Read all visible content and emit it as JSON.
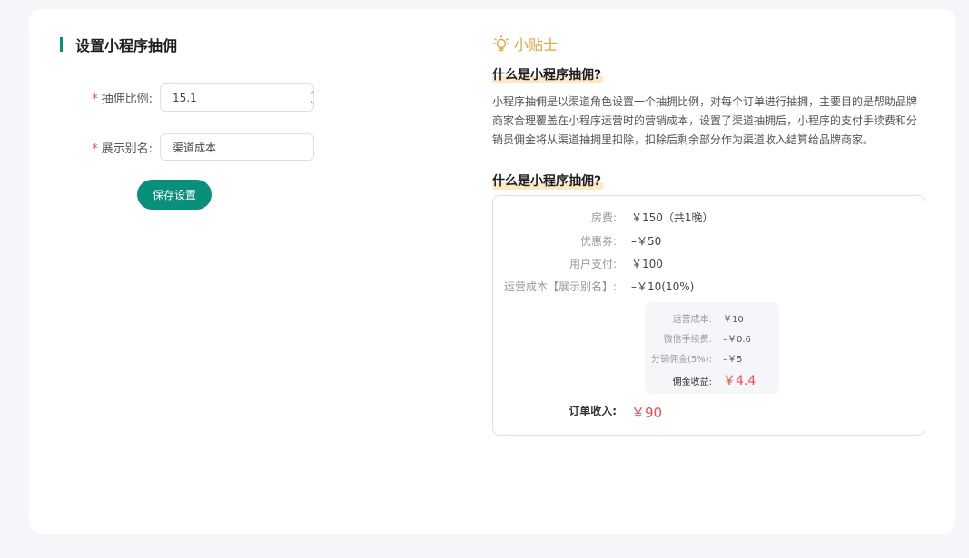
{
  "form": {
    "title": "设置小程序抽佣",
    "rate_label": "抽佣比例:",
    "rate_value": "15.1",
    "rate_unit": "%",
    "alias_label": "展示别名:",
    "alias_value": "渠道成本",
    "required_mark": "*",
    "save_label": "保存设置"
  },
  "tips": {
    "title": "小贴士",
    "q1": "什么是小程序抽佣?",
    "description": "小程序抽佣是以渠道角色设置一个抽拥比例，对每个订单进行抽拥，主要目的是帮助品牌商家合理覆盖在小程序运营时的营销成本，设置了渠道抽拥后，小程序的支付手续费和分销员佣金将从渠道抽拥里扣除，扣除后剩余部分作为渠道收入结算给品牌商家。",
    "q2": "什么是小程序抽佣?",
    "example": {
      "rows": [
        {
          "label": "房费:",
          "value": "￥150（共1晚）"
        },
        {
          "label": "优惠券:",
          "value": "–￥50"
        },
        {
          "label": "用户支付:",
          "value": "￥100"
        },
        {
          "label": "运营成本【展示别名】:",
          "value": "–￥10(10%)"
        }
      ],
      "breakdown": [
        {
          "label": "运营成本:",
          "value": "￥10"
        },
        {
          "label": "微信手续费:",
          "value": "–￥0.6"
        },
        {
          "label": "分销佣金(5%):",
          "value": "–￥5"
        },
        {
          "label": "佣金收益:",
          "value": "￥4.4"
        }
      ],
      "total_label": "订单收入:",
      "total_value": "￥90"
    }
  },
  "colors": {
    "accent": "#0a8f7b",
    "tips": "#e6a23c",
    "price_red": "#f04e4e",
    "background": "#f4f6fa"
  }
}
